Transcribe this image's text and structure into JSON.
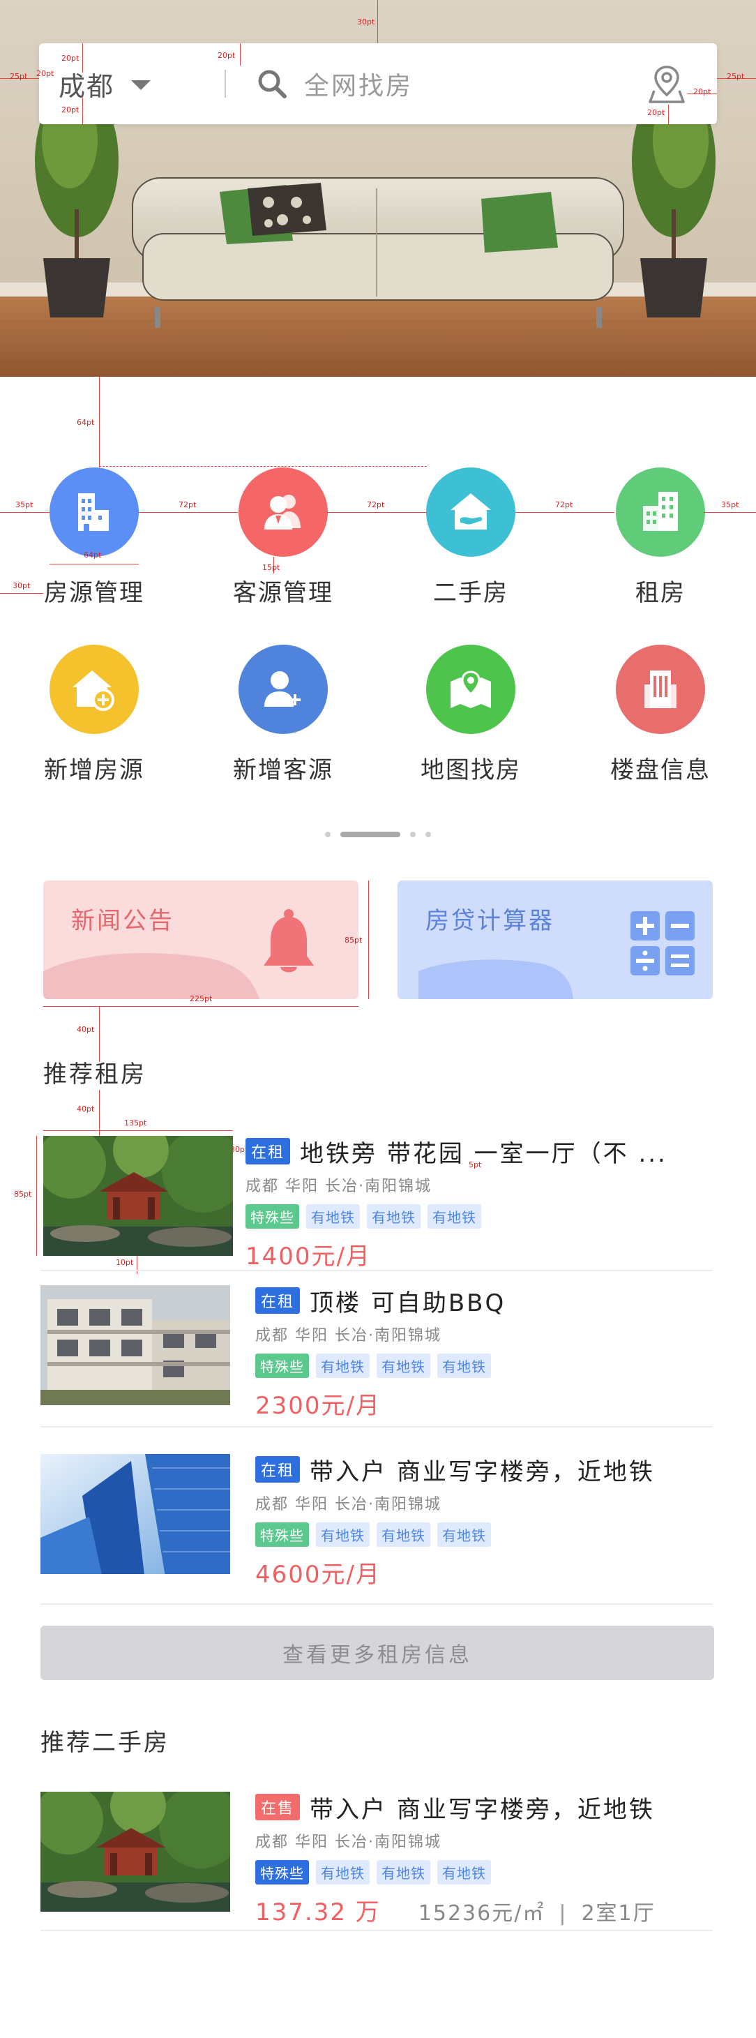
{
  "search": {
    "city": "成都",
    "placeholder": "全网找房"
  },
  "menu": [
    {
      "label": "房源管理",
      "icon": "building-icon",
      "color": "#5b8ff5"
    },
    {
      "label": "客源管理",
      "icon": "customers-icon",
      "color": "#f56666"
    },
    {
      "label": "二手房",
      "icon": "house-hand-icon",
      "color": "#3ec0d4"
    },
    {
      "label": "租房",
      "icon": "apartment-icon",
      "color": "#60cc7a"
    },
    {
      "label": "新增房源",
      "icon": "add-house-icon",
      "color": "#f5c22e"
    },
    {
      "label": "新增客源",
      "icon": "add-user-icon",
      "color": "#4f83dc"
    },
    {
      "label": "地图找房",
      "icon": "map-pin-icon",
      "color": "#4fc44d"
    },
    {
      "label": "楼盘信息",
      "icon": "tower-icon",
      "color": "#e86e6e"
    }
  ],
  "cards": {
    "news": {
      "title": "新闻公告",
      "icon": "bell-icon"
    },
    "loan": {
      "title": "房贷计算器",
      "icon": "calculator-icon"
    }
  },
  "rent_section": {
    "title": "推荐租房",
    "more_label": "查看更多租房信息",
    "items": [
      {
        "status": "在租",
        "title": "地铁旁 带花园 一室一厅（不 ...",
        "location": "成都 华阳  长冶·南阳锦城",
        "special": "特殊些",
        "subways": [
          "有地铁",
          "有地铁",
          "有地铁"
        ],
        "price": "1400元/月"
      },
      {
        "status": "在租",
        "title": "顶楼 可自助BBQ",
        "location": "成都 华阳  长冶·南阳锦城",
        "special": "特殊些",
        "subways": [
          "有地铁",
          "有地铁",
          "有地铁"
        ],
        "price": "2300元/月"
      },
      {
        "status": "在租",
        "title": "带入户 商业写字楼旁，近地铁",
        "location": "成都 华阳  长冶·南阳锦城",
        "special": "特殊些",
        "subways": [
          "有地铁",
          "有地铁",
          "有地铁"
        ],
        "price": "4600元/月"
      }
    ]
  },
  "sale_section": {
    "title": "推荐二手房",
    "items": [
      {
        "status": "在售",
        "title": "带入户 商业写字楼旁，近地铁",
        "location": "成都 华阳  长冶·南阳锦城",
        "special": "特殊些",
        "subways": [
          "有地铁",
          "有地铁",
          "有地铁"
        ],
        "price": "137.32 万",
        "unit_price": "15236元/㎡",
        "separator": "|",
        "layout": "2室1厅"
      }
    ]
  },
  "annotations": {
    "top": "30pt",
    "left_margin": "25pt",
    "right_margin": "25pt",
    "inner_left": "20pt",
    "inner_top": "20pt",
    "inner_bottom": "20pt",
    "search_gap": "20pt",
    "icon_right": "20pt",
    "icon_bottom": "20pt",
    "menu_top": "64pt",
    "menu_left": "35pt",
    "menu_gap_1": "72pt",
    "menu_gap_2": "72pt",
    "menu_gap_3": "72pt",
    "menu_right": "35pt",
    "icon_size": "64pt",
    "label_gap": "15pt",
    "label_left": "30pt",
    "card_height": "85pt",
    "card_width": "225pt",
    "section_gap": "40pt",
    "list_gap": "40pt",
    "thumb_width": "135pt",
    "thumb_height": "85pt",
    "thumb_gap": "30pt",
    "row_gap": "10pt",
    "line_gap": "5pt"
  }
}
